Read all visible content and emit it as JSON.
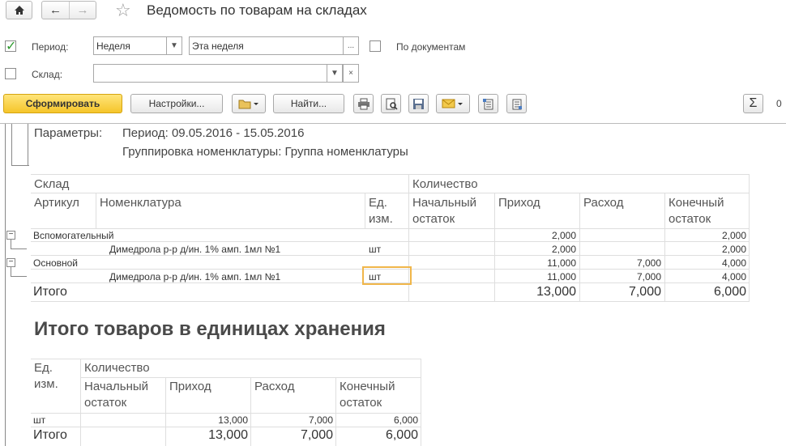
{
  "window": {
    "title": "Ведомость по товарам на складах"
  },
  "form": {
    "period_label": "Период:",
    "period_type": "Неделя",
    "period_value": "Эта неделя",
    "by_documents_label": "По документам",
    "warehouse_label": "Склад:",
    "warehouse_value": ""
  },
  "toolbar": {
    "generate_label": "Сформировать",
    "settings_label": "Настройки...",
    "find_label": "Найти...",
    "sum_value": "0"
  },
  "report": {
    "params_label": "Параметры:",
    "params_period": "Период: 09.05.2016 - 15.05.2016",
    "params_grouping": "Группировка номенклатуры: Группа номенклатуры",
    "header": {
      "warehouse": "Склад",
      "quantity": "Количество",
      "article": "Артикул",
      "item": "Номенклатура",
      "unit": "Ед. изм.",
      "opening": "Начальный остаток",
      "income": "Приход",
      "expense": "Расход",
      "closing": "Конечный остаток"
    },
    "groups": [
      {
        "name": "Вспомогательный",
        "opening": "",
        "income": "2,000",
        "expense": "",
        "closing": "2,000",
        "item": {
          "name": "Димедрола р-р д/ин. 1% амп. 1мл №1",
          "unit": "шт",
          "opening": "",
          "income": "2,000",
          "expense": "",
          "closing": "2,000"
        }
      },
      {
        "name": "Основной",
        "opening": "",
        "income": "11,000",
        "expense": "7,000",
        "closing": "4,000",
        "item": {
          "name": "Димедрола р-р д/ин. 1% амп. 1мл №1",
          "unit": "шт",
          "opening": "",
          "income": "11,000",
          "expense": "7,000",
          "closing": "4,000"
        }
      }
    ],
    "total": {
      "label": "Итого",
      "opening": "",
      "income": "13,000",
      "expense": "7,000",
      "closing": "6,000"
    }
  },
  "summary": {
    "title": "Итого товаров в единицах хранения",
    "header": {
      "unit": "Ед. изм.",
      "quantity": "Количество",
      "opening": "Начальный остаток",
      "income": "Приход",
      "expense": "Расход",
      "closing": "Конечный остаток"
    },
    "row": {
      "unit": "шт",
      "opening": "",
      "income": "13,000",
      "expense": "7,000",
      "closing": "6,000"
    },
    "total": {
      "label": "Итого",
      "opening": "",
      "income": "13,000",
      "expense": "7,000",
      "closing": "6,000"
    }
  }
}
